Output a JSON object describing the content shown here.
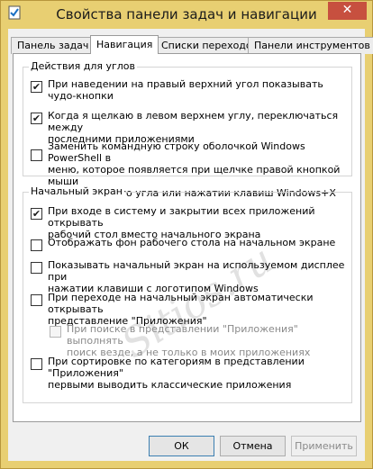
{
  "window": {
    "title": "Свойства панели задач и навигации",
    "close_glyph": "✕",
    "colors": {
      "frame": "#e8cf72",
      "close": "#c7503f"
    }
  },
  "tabs": [
    {
      "label": "Панель задач",
      "active": false
    },
    {
      "label": "Навигация",
      "active": true
    },
    {
      "label": "Списки переходов",
      "active": false
    },
    {
      "label": "Панели инструментов",
      "active": false
    }
  ],
  "corners_group": {
    "title": "Действия для углов",
    "options": [
      {
        "lines": [
          "При наведении на правый верхний угол показывать",
          "чудо-кнопки"
        ],
        "checked": true,
        "disabled": false
      },
      {
        "lines": [
          "Когда я щелкаю в левом верхнем углу, переключаться между",
          "последними приложениями"
        ],
        "checked": true,
        "disabled": false
      },
      {
        "lines": [
          "Заменить командную строку оболочкой Windows PowerShell в",
          "меню, которое появляется при щелчке правой кнопкой мыши",
          "левого нижнего угла или нажатии клавиш Windows+X"
        ],
        "checked": false,
        "disabled": false
      }
    ]
  },
  "start_group": {
    "title": "Начальный экран",
    "options": [
      {
        "lines": [
          "При входе в систему и закрытии всех приложений открывать",
          "рабочий стол вместо начального экрана"
        ],
        "checked": true,
        "disabled": false
      },
      {
        "lines": [
          "Отображать фон рабочего стола на начальном экране"
        ],
        "checked": false,
        "disabled": false
      },
      {
        "lines": [
          "Показывать начальный экран на используемом дисплее при",
          "нажатии клавиши с логотипом Windows"
        ],
        "checked": false,
        "disabled": false
      },
      {
        "lines": [
          "При переходе на начальный экран автоматически открывать",
          "представление \"Приложения\""
        ],
        "checked": false,
        "disabled": false
      },
      {
        "lines": [
          "При поиске в представлении \"Приложения\" выполнять",
          "поиск везде, а не только в моих приложениях"
        ],
        "checked": false,
        "disabled": true
      },
      {
        "lines": [
          "При сортировке по категориям в представлении \"Приложения\"",
          "первыми выводить классические приложения"
        ],
        "checked": false,
        "disabled": false
      }
    ]
  },
  "watermark": "Sitios.ru",
  "buttons": {
    "ok": "ОК",
    "cancel": "Отмена",
    "apply": "Применить"
  }
}
